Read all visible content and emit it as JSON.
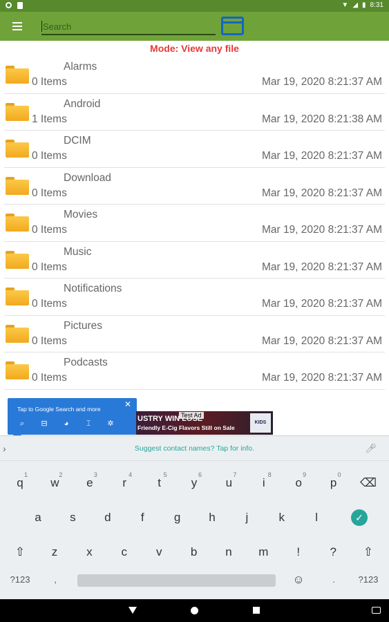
{
  "status": {
    "time": "8:31"
  },
  "toolbar": {
    "search_placeholder": "Search"
  },
  "mode_text": "Mode: View any file",
  "files": [
    {
      "name": "Alarms",
      "count": "0 Items",
      "date": "Mar 19, 2020 8:21:37 AM"
    },
    {
      "name": "Android",
      "count": "1 Items",
      "date": "Mar 19, 2020 8:21:38 AM"
    },
    {
      "name": "DCIM",
      "count": "0 Items",
      "date": "Mar 19, 2020 8:21:37 AM"
    },
    {
      "name": "Download",
      "count": "0 Items",
      "date": "Mar 19, 2020 8:21:37 AM"
    },
    {
      "name": "Movies",
      "count": "0 Items",
      "date": "Mar 19, 2020 8:21:37 AM"
    },
    {
      "name": "Music",
      "count": "0 Items",
      "date": "Mar 19, 2020 8:21:37 AM"
    },
    {
      "name": "Notifications",
      "count": "0 Items",
      "date": "Mar 19, 2020 8:21:37 AM"
    },
    {
      "name": "Pictures",
      "count": "0 Items",
      "date": "Mar 19, 2020 8:21:37 AM"
    },
    {
      "name": "Podcasts",
      "count": "0 Items",
      "date": "Mar 19, 2020 8:21:37 AM"
    }
  ],
  "google_popup": {
    "title": "Tap to Google Search and more",
    "close": "✕"
  },
  "ad": {
    "line1": "USTRY WIN    LOSE",
    "line2": "Friendly E-Cig Flavors Still on Sale",
    "test_label": "Test Ad",
    "logo": "KIDS"
  },
  "keyboard": {
    "suggestion": "Suggest contact names? Tap for info.",
    "row1": [
      {
        "k": "q",
        "n": "1"
      },
      {
        "k": "w",
        "n": "2"
      },
      {
        "k": "e",
        "n": "3"
      },
      {
        "k": "r",
        "n": "4"
      },
      {
        "k": "t",
        "n": "5"
      },
      {
        "k": "y",
        "n": "6"
      },
      {
        "k": "u",
        "n": "7"
      },
      {
        "k": "i",
        "n": "8"
      },
      {
        "k": "o",
        "n": "9"
      },
      {
        "k": "p",
        "n": "0"
      }
    ],
    "row2": [
      "a",
      "s",
      "d",
      "f",
      "g",
      "h",
      "j",
      "k",
      "l"
    ],
    "row3": [
      "z",
      "x",
      "c",
      "v",
      "b",
      "n",
      "m",
      "!",
      "?"
    ],
    "sym_left": "?123",
    "sym_right": "?123",
    "comma": ",",
    "period": "."
  }
}
